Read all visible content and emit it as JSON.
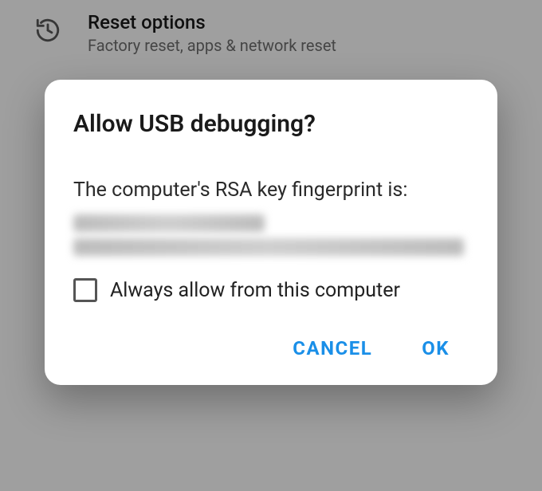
{
  "background": {
    "resetOptions": {
      "title": "Reset options",
      "subtitle": "Factory reset, apps & network reset"
    }
  },
  "dialog": {
    "title": "Allow USB debugging?",
    "message": "The computer's RSA key fingerprint is:",
    "checkboxLabel": "Always allow from this computer",
    "checkboxChecked": false,
    "actions": {
      "cancel": "CANCEL",
      "ok": "OK"
    }
  }
}
